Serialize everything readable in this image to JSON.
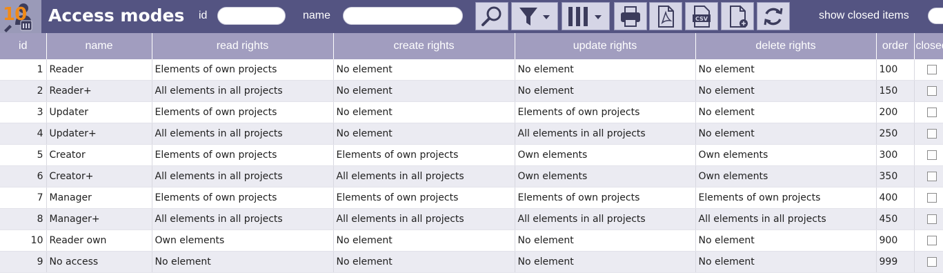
{
  "header": {
    "logo_number": "10",
    "title": "Access modes",
    "filter_id_label": "id",
    "filter_id_value": "",
    "filter_name_label": "name",
    "filter_name_value": "",
    "show_closed_label": "show closed items"
  },
  "toolbar": {
    "buttons": [
      "search-icon",
      "filter-icon",
      "columns-icon",
      "print-icon",
      "pdf-icon",
      "csv-icon",
      "new-item-icon",
      "refresh-icon"
    ]
  },
  "colors": {
    "topbar": "#545482",
    "header_row": "#a19dbf",
    "row_alt": "#ebebf2",
    "logo_number": "#f08a18"
  },
  "table": {
    "columns": [
      "id",
      "name",
      "read rights",
      "create rights",
      "update rights",
      "delete rights",
      "order",
      "closed"
    ],
    "rows": [
      {
        "id": "1",
        "name": "Reader",
        "read": "Elements of own projects",
        "create": "No element",
        "update": "No element",
        "delete": "No element",
        "order": "100",
        "closed": false
      },
      {
        "id": "2",
        "name": "Reader+",
        "read": "All elements in all projects",
        "create": "No element",
        "update": "No element",
        "delete": "No element",
        "order": "150",
        "closed": false
      },
      {
        "id": "3",
        "name": "Updater",
        "read": "Elements of own projects",
        "create": "No element",
        "update": "Elements of own projects",
        "delete": "No element",
        "order": "200",
        "closed": false
      },
      {
        "id": "4",
        "name": "Updater+",
        "read": "All elements in all projects",
        "create": "No element",
        "update": "All elements in all projects",
        "delete": "No element",
        "order": "250",
        "closed": false
      },
      {
        "id": "5",
        "name": "Creator",
        "read": "Elements of own projects",
        "create": "Elements of own projects",
        "update": "Own elements",
        "delete": "Own elements",
        "order": "300",
        "closed": false
      },
      {
        "id": "6",
        "name": "Creator+",
        "read": "All elements in all projects",
        "create": "All elements in all projects",
        "update": "Own elements",
        "delete": "Own elements",
        "order": "350",
        "closed": false
      },
      {
        "id": "7",
        "name": "Manager",
        "read": "Elements of own projects",
        "create": "Elements of own projects",
        "update": "Elements of own projects",
        "delete": "Elements of own projects",
        "order": "400",
        "closed": false
      },
      {
        "id": "8",
        "name": "Manager+",
        "read": "All elements in all projects",
        "create": "All elements in all projects",
        "update": "All elements in all projects",
        "delete": "All elements in all projects",
        "order": "450",
        "closed": false
      },
      {
        "id": "10",
        "name": "Reader own",
        "read": "Own elements",
        "create": "No element",
        "update": "No element",
        "delete": "No element",
        "order": "900",
        "closed": false
      },
      {
        "id": "9",
        "name": "No access",
        "read": "No element",
        "create": "No element",
        "update": "No element",
        "delete": "No element",
        "order": "999",
        "closed": false
      }
    ]
  }
}
